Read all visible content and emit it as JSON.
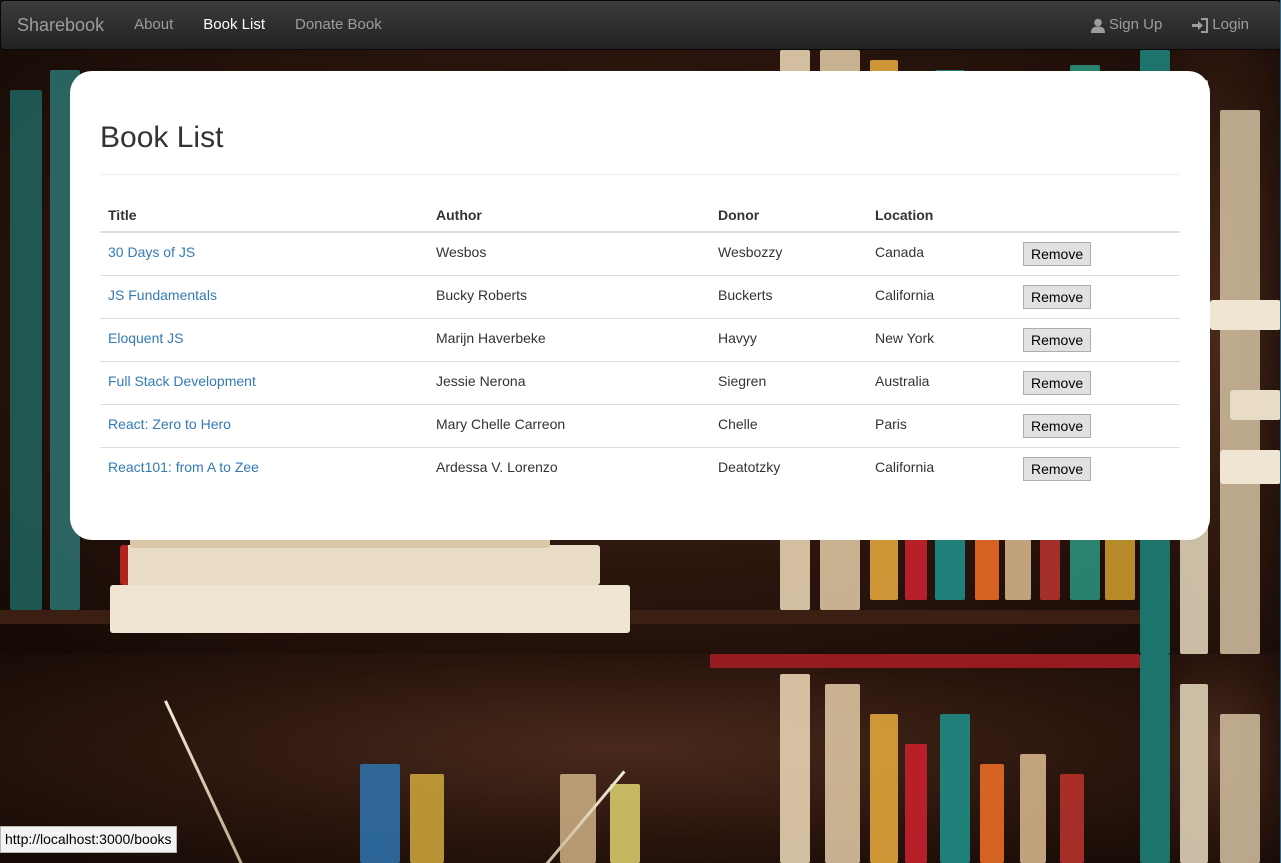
{
  "navbar": {
    "brand": "Sharebook",
    "links": [
      {
        "label": "About"
      },
      {
        "label": "Book List"
      },
      {
        "label": "Donate Book"
      }
    ],
    "right": [
      {
        "label": "Sign Up",
        "icon": "user-icon"
      },
      {
        "label": "Login",
        "icon": "login-icon"
      }
    ]
  },
  "page": {
    "title": "Book List"
  },
  "table": {
    "headers": [
      "Title",
      "Author",
      "Donor",
      "Location",
      ""
    ],
    "rows": [
      {
        "title": "30 Days of JS",
        "author": "Wesbos",
        "donor": "Wesbozzy",
        "location": "Canada",
        "action": "Remove"
      },
      {
        "title": "JS Fundamentals",
        "author": "Bucky Roberts",
        "donor": "Buckerts",
        "location": "California",
        "action": "Remove"
      },
      {
        "title": "Eloquent JS",
        "author": "Marijn Haverbeke",
        "donor": "Havyy",
        "location": "New York",
        "action": "Remove"
      },
      {
        "title": "Full Stack Development",
        "author": "Jessie Nerona",
        "donor": "Siegren",
        "location": "Australia",
        "action": "Remove"
      },
      {
        "title": "React: Zero to Hero",
        "author": "Mary Chelle Carreon",
        "donor": "Chelle",
        "location": "Paris",
        "action": "Remove"
      },
      {
        "title": "React101: from A to Zee",
        "author": "Ardessa V. Lorenzo",
        "donor": "Deatotzky",
        "location": "California",
        "action": "Remove"
      }
    ]
  },
  "status_bar": {
    "url": "http://localhost:3000/books"
  },
  "colors": {
    "link": "#337ab7",
    "navbar_bg": "#222222",
    "nav_active": "#ffffff",
    "nav_inactive": "#9d9d9d"
  }
}
